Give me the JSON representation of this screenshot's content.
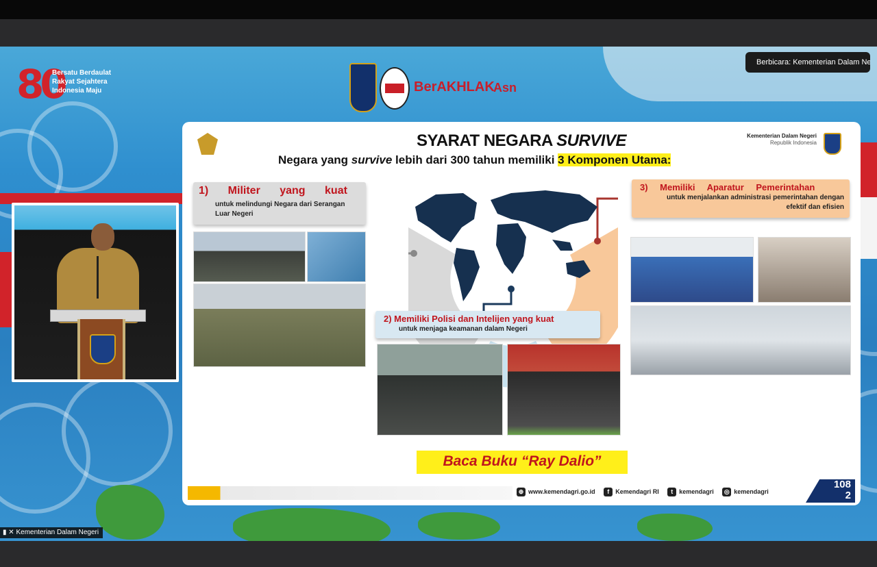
{
  "window": {
    "speaking_indicator": "Berbicara: Kementerian Dalam Ne..."
  },
  "participant": {
    "name": "Kementerian Dalam Negeri"
  },
  "event_logo": {
    "number": "80",
    "tagline": "Bersatu Berdaulat Rakyat Sejahtera Indonesia Maju"
  },
  "header_logos": {
    "brand1": "BerAKHLAK",
    "brand2": "Asn"
  },
  "slide": {
    "title_prefix": "SYARAT NEGARA ",
    "title_italic": "SURVIVE",
    "subtitle_a": "Negara yang ",
    "subtitle_italic": "survive",
    "subtitle_b": " lebih dari 300 tahun memiliki ",
    "subtitle_hl": "3 Komponen Utama:",
    "ministry": "Kementerian Dalam Negeri",
    "ministry_sub": "Republik Indonesia",
    "component1": {
      "title": "1) Militer yang kuat",
      "desc": "untuk melindungi Negara dari Serangan Luar Negeri"
    },
    "component2": {
      "title": "2) Memiliki Polisi dan Intelijen yang kuat",
      "desc": "untuk menjaga keamanan dalam Negeri"
    },
    "component3": {
      "title": "3) Memiliki Aparatur Pemerintahan",
      "desc": "untuk menjalankan administrasi pemerintahan dengan efektif dan efisien"
    },
    "callout": "Baca Buku “Ray Dalio”",
    "footer": {
      "website": "www.kemendagri.go.id",
      "facebook": "Kemendagri RI",
      "twitter": "kemendagri",
      "instagram": "kemendagri"
    },
    "page_number": "108",
    "page_number_line2": "2"
  },
  "colors": {
    "accent_red": "#c0151d",
    "highlight_yellow": "#ffef1a",
    "navy": "#13306b"
  },
  "icons": [
    "garuda-emblem",
    "kemendagri-emblem",
    "globe-icon",
    "facebook-icon",
    "twitter-icon",
    "instagram-icon",
    "signal-icon",
    "mic-muted-icon"
  ]
}
